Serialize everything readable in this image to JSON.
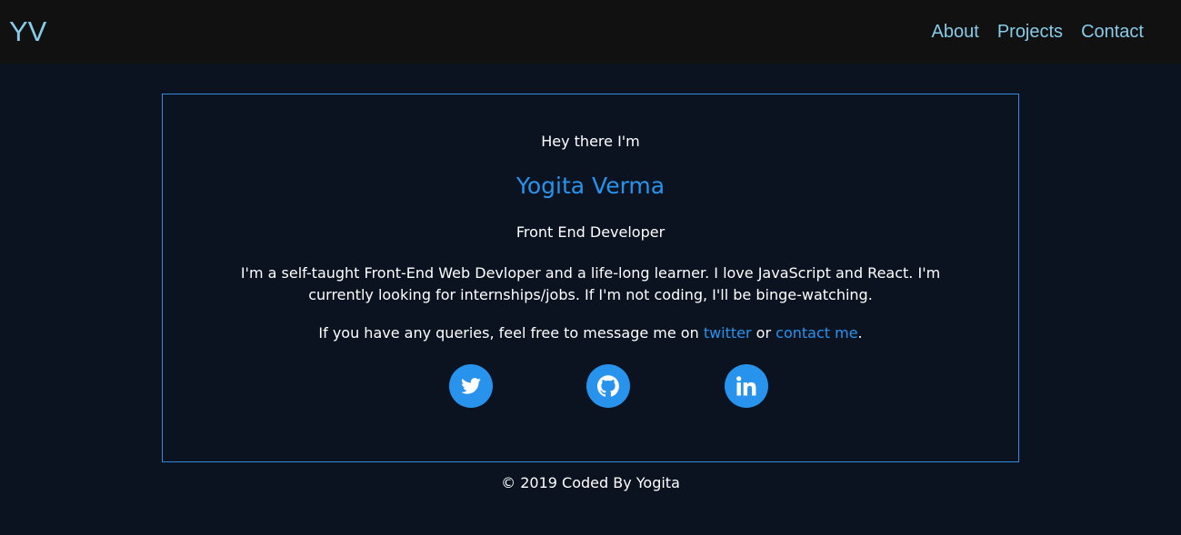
{
  "nav": {
    "brand": "YV",
    "links": [
      "About",
      "Projects",
      "Contact"
    ],
    "link_color": "#87cbe9",
    "background": "#111111"
  },
  "hero": {
    "greeting": "Hey there I'm",
    "name": "Yogita Verma",
    "role": "Front End Developer",
    "bio": "I'm a self-taught Front-End Web Devloper and a life-long learner. I love JavaScript and React. I'm currently looking for internships/jobs. If I'm not coding, I'll be binge-watching.",
    "contact_prefix": "If you have any queries, feel free to message me on ",
    "twitter_link": "twitter",
    "contact_middle": " or ",
    "contact_link": "contact me",
    "contact_suffix": ".",
    "accent_color": "#2793ec",
    "border_color": "#2f8ae0"
  },
  "socials": [
    {
      "icon": "twitter-icon"
    },
    {
      "icon": "github-icon"
    },
    {
      "icon": "linkedin-icon"
    }
  ],
  "footer": {
    "text": "© 2019 Coded By Yogita"
  },
  "page_background": "#0c1320"
}
